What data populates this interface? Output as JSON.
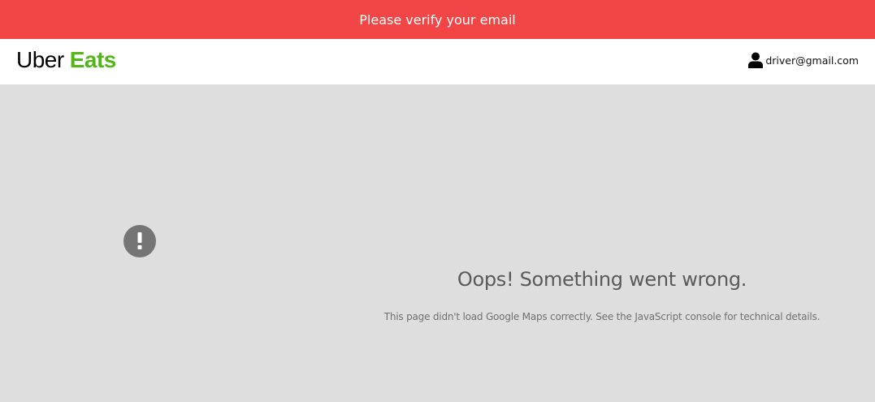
{
  "banner": {
    "text": "Please verify your email",
    "color": "#f24545"
  },
  "header": {
    "logo": {
      "part1": "Uber",
      "part2": "Eats",
      "accent_color": "#52b616"
    },
    "user": {
      "icon": "user-icon",
      "email": "driver@gmail.com"
    }
  },
  "map": {
    "background": "#dedede",
    "error": {
      "icon": "exclamation-icon",
      "title": "Oops! Something went wrong.",
      "message": "This page didn't load Google Maps correctly. See the JavaScript console for technical details."
    }
  }
}
